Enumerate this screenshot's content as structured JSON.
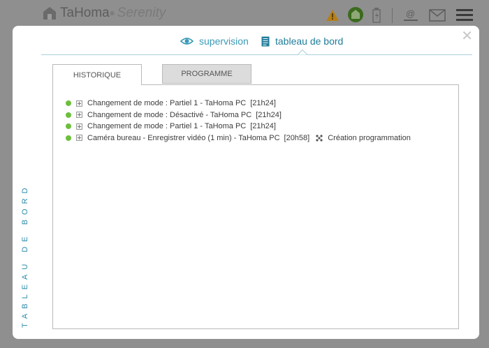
{
  "header": {
    "brand": "TaHoma",
    "reg": "®",
    "product": "Serenity",
    "icons": [
      "home-icon",
      "warning-icon",
      "house-status-icon",
      "battery-icon",
      "at-sign-icon",
      "mail-icon",
      "menu-icon"
    ]
  },
  "modal": {
    "close_symbol": "✕",
    "nav": [
      {
        "label": "supervision",
        "icon": "eye-icon"
      },
      {
        "label": "tableau de bord",
        "icon": "document-icon",
        "active": true
      }
    ],
    "side_title": "TABLEAU DE BORD",
    "tabs": [
      {
        "label": "HISTORIQUE",
        "active": true
      },
      {
        "label": "PROGRAMME",
        "active": false
      }
    ],
    "history": [
      {
        "text": "Changement de mode : Partiel 1 - TaHoma PC",
        "time": "[21h24]",
        "extra": ""
      },
      {
        "text": "Changement de mode : Désactivé - TaHoma PC",
        "time": "[21h24]",
        "extra": ""
      },
      {
        "text": "Changement de mode : Partiel 1 - TaHoma PC",
        "time": "[21h24]",
        "extra": ""
      },
      {
        "text": "Caméra bureau - Enregistrer vidéo (1 min) - TaHoma PC",
        "time": "[20h58]",
        "extra": "Création programmation"
      }
    ],
    "colors": {
      "accent": "#2b8aa9",
      "status_ok": "#6cbf3c"
    }
  }
}
